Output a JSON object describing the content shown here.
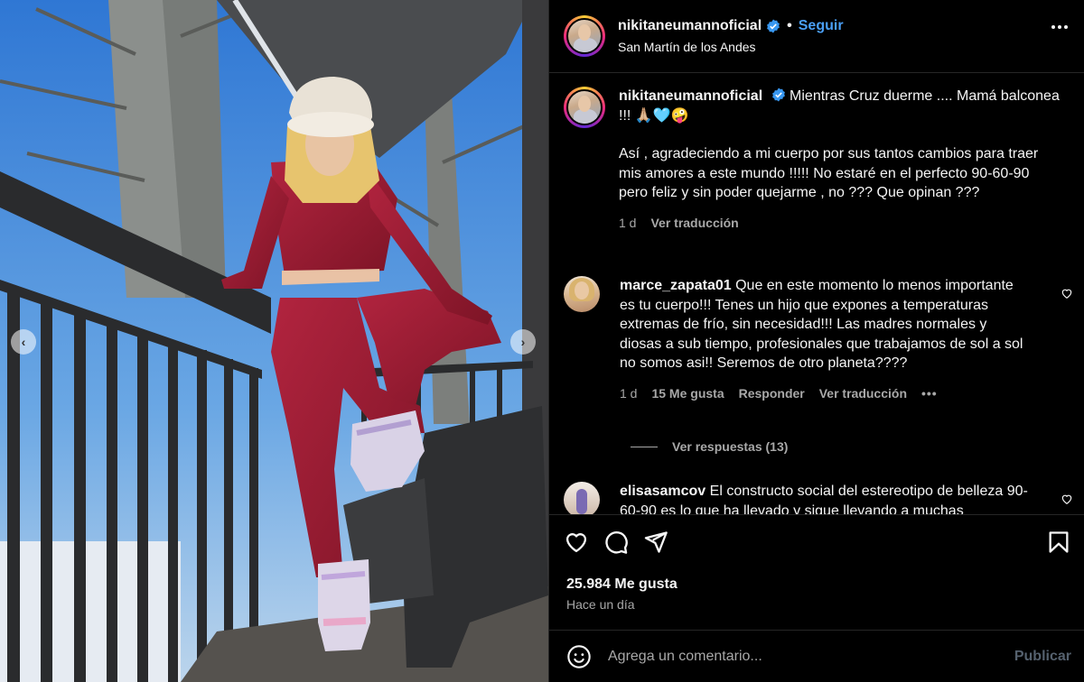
{
  "post": {
    "username": "nikitaneumannoficial",
    "follow_label": "Seguir",
    "separator": "•",
    "location": "San Martín de los Andes"
  },
  "caption": {
    "username": "nikitaneumannoficial",
    "line1": "Mientras Cruz duerme .... Mamá balconea !!! 🙏🏼🩵🤪",
    "line2": "Así , agradeciendo a mi cuerpo por sus tantos cambios para traer mis amores a este mundo !!!!! No estaré en el perfecto 90-60-90 pero feliz y sin poder quejarme , no ??? Que opinan ???",
    "time": "1 d",
    "translate": "Ver traducción"
  },
  "comments": [
    {
      "username": "marce_zapata01",
      "text": "Que en este momento lo menos importante es tu cuerpo!!! Tenes un hijo que expones a temperaturas extremas de frío, sin necesidad!!! Las madres normales y diosas a sub tiempo, profesionales que trabajamos de sol a sol no somos asi!! Seremos de otro planeta????",
      "time": "1 d",
      "likes": "15 Me gusta",
      "reply": "Responder",
      "translate": "Ver traducción",
      "more": "•••",
      "view_replies": "Ver respuestas (13)"
    },
    {
      "username": "elisasamcov",
      "text": "El constructo social del estereotipo de belleza 90-60-90 es lo que ha llevado y sigue llevando a muchas"
    }
  ],
  "stats": {
    "likes": "25.984 Me gusta",
    "posted": "Hace un día"
  },
  "composer": {
    "placeholder": "Agrega un comentario...",
    "publish": "Publicar"
  },
  "media": {
    "prev": "‹",
    "next": "›"
  },
  "icons": [
    "heart-icon",
    "comment-icon",
    "share-icon",
    "bookmark-icon",
    "emoji-icon",
    "verified-icon",
    "more-icon"
  ],
  "colors": {
    "accent_blue": "#4a9ff5",
    "verified": "#3897f0",
    "secondary_text": "#a8a8a8",
    "publish_disabled": "#55616e"
  }
}
